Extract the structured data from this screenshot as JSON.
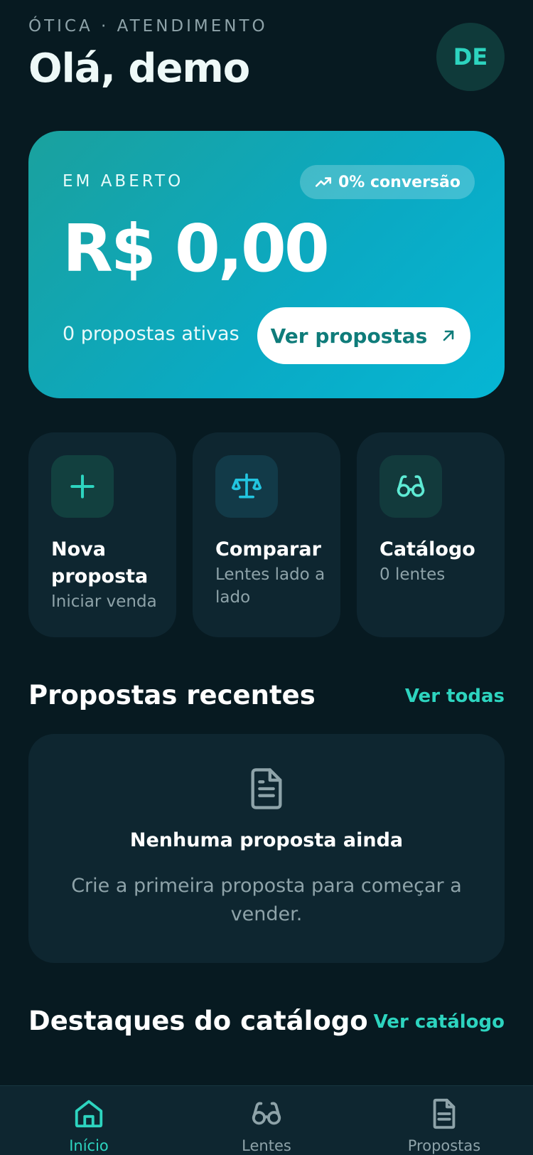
{
  "header": {
    "eyebrow": "ÓTICA · ATENDIMENTO",
    "greeting": "Olá, demo",
    "avatar_initials": "DE"
  },
  "summary": {
    "eyebrow": "EM ABERTO",
    "conversion_badge": "0% conversão",
    "amount": "R$ 0,00",
    "active_count": "0 propostas ativas",
    "cta_label": "Ver propostas"
  },
  "quick_actions": [
    {
      "title": "Nova proposta",
      "subtitle": "Iniciar venda",
      "icon": "plus-icon"
    },
    {
      "title": "Comparar",
      "subtitle": "Lentes lado a lado",
      "icon": "scale-icon"
    },
    {
      "title": "Catálogo",
      "subtitle": "0 lentes",
      "icon": "glasses-icon"
    }
  ],
  "recent": {
    "title": "Propostas recentes",
    "link": "Ver todas",
    "empty_title": "Nenhuma proposta ainda",
    "empty_subtitle": "Crie a primeira proposta para começar a vender."
  },
  "catalog": {
    "title": "Destaques do catálogo",
    "link": "Ver catálogo"
  },
  "nav": [
    {
      "label": "Início",
      "icon": "home-icon",
      "active": true
    },
    {
      "label": "Lentes",
      "icon": "glasses-icon",
      "active": false
    },
    {
      "label": "Propostas",
      "icon": "document-icon",
      "active": false
    }
  ],
  "colors": {
    "background": "#071a21",
    "card": "#0e2630",
    "accent": "#2dd4bf",
    "hero_start": "#1aa19e",
    "hero_end": "#06b6d4"
  }
}
